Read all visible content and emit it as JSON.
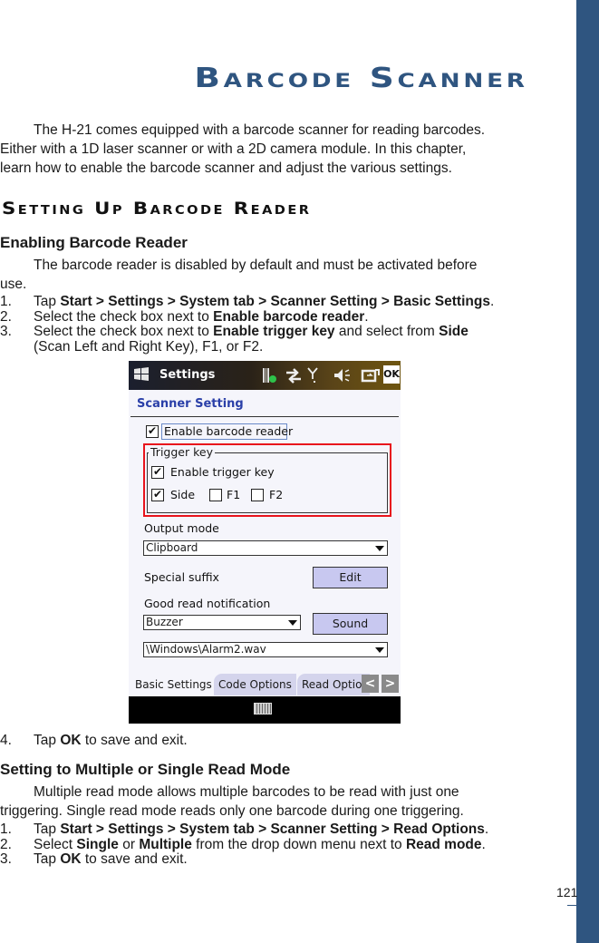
{
  "chapter_title": "Barcode Scanner",
  "intro": "The H-21 comes equipped with a barcode scanner for reading barcodes. Either with a 1D laser scanner or with a 2D camera module. In this chapter, learn how to enable the barcode scanner and adjust the various settings.",
  "intro_lines": [
    "The H-21 comes equipped with a barcode scanner for reading barcodes.",
    "Either with a 1D laser scanner or with a 2D camera module. In this chapter,",
    "learn how to enable the barcode scanner and adjust the various settings."
  ],
  "section_title": "Setting Up Barcode Reader",
  "enabling": {
    "heading": "Enabling Barcode Reader",
    "para_lines": [
      "The barcode reader is disabled by default and must be activated before",
      "use."
    ],
    "steps": [
      {
        "num": "1.",
        "parts": [
          {
            "t": "Tap "
          },
          {
            "b": "Start > Settings > System tab > Scanner Setting > Basic Settings"
          },
          {
            "t": "."
          }
        ]
      },
      {
        "num": "2.",
        "parts": [
          {
            "t": "Select the check box next to "
          },
          {
            "b": "Enable barcode reader"
          },
          {
            "t": "."
          }
        ]
      },
      {
        "num": "3.",
        "parts": [
          {
            "t": "Select the check box next to "
          },
          {
            "b": "Enable trigger key"
          },
          {
            "t": " and select from "
          },
          {
            "b": "Side"
          }
        ]
      },
      {
        "num": "",
        "parts": [
          {
            "t": "(Scan Left and Right Key), F1, or F2."
          }
        ]
      }
    ],
    "step4": {
      "num": "4.",
      "parts": [
        {
          "t": "Tap "
        },
        {
          "b": "OK"
        },
        {
          "t": " to save and exit."
        }
      ]
    }
  },
  "device": {
    "title": "Settings",
    "ok": "OK",
    "status_icons": [
      "scanner-status-icon",
      "connectivity-icon",
      "signal-icon",
      "volume-muted-icon",
      "battery-charging-icon"
    ],
    "heading": "Scanner Setting",
    "enable_reader": {
      "label": "Enable barcode reader",
      "checked": true
    },
    "trigger_group": "Trigger key",
    "enable_trigger": {
      "label": "Enable trigger key",
      "checked": true
    },
    "side": {
      "label": "Side",
      "checked": true
    },
    "f1": {
      "label": "F1",
      "checked": false
    },
    "f2": {
      "label": "F2",
      "checked": false
    },
    "output_mode_label": "Output mode",
    "output_mode_value": "Clipboard",
    "special_suffix_label": "Special suffix",
    "edit_button": "Edit",
    "good_read_label": "Good read notification",
    "good_read_value": "Buzzer",
    "sound_button": "Sound",
    "sound_file_value": "\\Windows\\Alarm2.wav",
    "tabs": [
      "Basic Settings",
      "Code Options",
      "Read Optio"
    ],
    "nav_prev": "<",
    "nav_next": ">",
    "highlight_color": "#e8141c"
  },
  "read_mode": {
    "heading": "Setting to Multiple or Single Read Mode",
    "para_lines": [
      "Multiple read mode allows multiple barcodes to be read with just one",
      "triggering. Single read mode reads only one barcode during one triggering."
    ],
    "steps": [
      {
        "num": "1.",
        "parts": [
          {
            "t": "Tap "
          },
          {
            "b": "Start > Settings > System tab > Scanner Setting > Read Options"
          },
          {
            "t": "."
          }
        ]
      },
      {
        "num": "2.",
        "parts": [
          {
            "t": "Select "
          },
          {
            "b": "Single"
          },
          {
            "t": " or "
          },
          {
            "b": "Multiple"
          },
          {
            "t": " from the drop down menu next to "
          },
          {
            "b": "Read mode"
          },
          {
            "t": "."
          }
        ]
      },
      {
        "num": "3.",
        "parts": [
          {
            "t": "Tap "
          },
          {
            "b": "OK"
          },
          {
            "t": " to save and exit."
          }
        ]
      }
    ]
  },
  "page_number": "121",
  "accent_color": "#2f5580"
}
